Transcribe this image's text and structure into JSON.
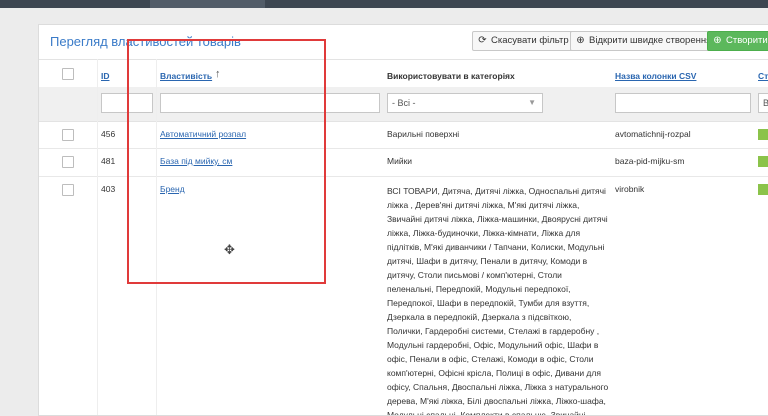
{
  "page_title": "Перегляд властивостей товарів",
  "toolbar": {
    "reset_filter": "Скасувати фільтр",
    "open_quick_create": "Відкрити швидке створення",
    "create": "Створити в"
  },
  "columns": {
    "id": "ID",
    "property": "Властивість",
    "sort_indicator": "↑",
    "use_in_categories": "Використовувати в категоріях",
    "csv_column_name": "Назва колонки CSV",
    "extra": "Ст"
  },
  "filters": {
    "category_select_value": "- Всі -",
    "last_partial": "В"
  },
  "rows": [
    {
      "id": "456",
      "property": "Автоматичний розпал",
      "categories": "Варильні поверхні",
      "csv": "avtomatichnij-rozpal"
    },
    {
      "id": "481",
      "property": "База під мийку, см",
      "categories": "Мийки",
      "csv": "baza-pid-mijku-sm"
    },
    {
      "id": "403",
      "property": "Бренд",
      "categories": "ВСІ ТОВАРИ, Дитяча, Дитячі ліжка, Односпальні дитячі ліжка , Дерев'яні дитячі ліжка, М'які дитячі ліжка, Звичайні дитячі ліжка, Ліжка-машинки, Двоярусні дитячі ліжка, Ліжка-будиночки, Ліжка-кімнати, Ліжка для підлітків, М'які диванчики / Тапчани, Колиски, Модульні дитячі, Шафи в дитячу, Пенали в дитячу, Комоди в дитячу, Столи письмові / комп'ютерні, Столи пеленальні, Передпокій, Модульні передпокої, Передпокої, Шафи в передпокій, Тумби для взуття, Дзеркала в передпокій, Дзеркала з підсвіткою, Полички, Гардеробні системи, Стелажі в гардеробну , Модульні гардеробні, Офіс, Модульний офіс, Шафи в офіс, Пенали в офіс, Стелажі, Комоди в офіс, Столи комп'ютерні, Офісні крісла, Полиці в офіс, Дивани для офісу, Спальня, Двоспальні ліжка, Ліжка з натурального дерева, М'які ліжка, Білі двоспальні ліжка, Ліжко-шафа, Модульні спальні, Комплекти в спальню, Звичайні ліжка з ДСП / МДФ,",
      "csv": "virobnik"
    }
  ]
}
